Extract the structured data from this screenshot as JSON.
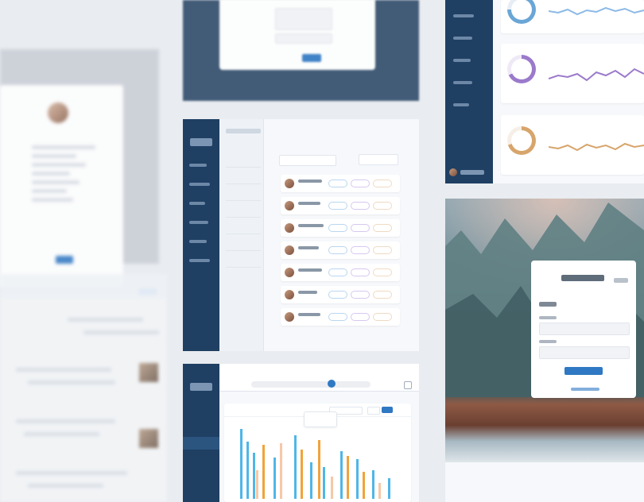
{
  "screens": {
    "top_center_dialog": {
      "title": "",
      "fields": [
        {
          "label": "",
          "value": ""
        },
        {
          "label": "",
          "value": ""
        },
        {
          "label": "",
          "value": ""
        }
      ],
      "buttons": [
        {
          "label": ""
        },
        {
          "label": ""
        }
      ]
    },
    "left_profile_dialog": {
      "title": "",
      "lines": [
        ""
      ],
      "button": ""
    },
    "list_screen": {
      "title": "",
      "subtitle": "",
      "sidebar_items": [
        "",
        "",
        "",
        "",
        "",
        "",
        "",
        ""
      ],
      "filter_items": [
        "",
        "",
        "",
        "",
        "",
        "",
        ""
      ],
      "search_placeholder": "",
      "sort_label": "",
      "rows": [
        {
          "name": "",
          "meta": "",
          "tags": [
            "",
            "",
            ""
          ]
        },
        {
          "name": "",
          "meta": "",
          "tags": [
            "",
            "",
            ""
          ]
        },
        {
          "name": "",
          "meta": "",
          "tags": [
            "",
            "",
            ""
          ]
        },
        {
          "name": "",
          "meta": "",
          "tags": [
            "",
            "",
            ""
          ]
        },
        {
          "name": "",
          "meta": "",
          "tags": [
            "",
            "",
            ""
          ]
        },
        {
          "name": "",
          "meta": "",
          "tags": [
            "",
            "",
            ""
          ]
        },
        {
          "name": "",
          "meta": "",
          "tags": [
            "",
            "",
            ""
          ]
        }
      ]
    },
    "analytics_screen": {
      "sidebar_items": [
        "",
        "",
        "",
        "",
        ""
      ],
      "kpis": [
        {
          "label": "",
          "value": ""
        },
        {
          "label": "",
          "value": ""
        },
        {
          "label": "",
          "value": ""
        }
      ],
      "footer_user": ""
    },
    "bar_chart_screen": {
      "title": "",
      "subtitle": "",
      "paginator": "",
      "chart_title": "",
      "legend": [
        "",
        "",
        ""
      ],
      "tooltip": ""
    },
    "login_screen": {
      "brand": "",
      "language": "",
      "heading": "",
      "field_labels": [
        "",
        ""
      ],
      "button": "",
      "link": ""
    }
  },
  "colors": {
    "navy": "#1f3f63",
    "accent": "#2f78c3",
    "bg": "#e9ecf0",
    "ring_blue": "#6aa6d6",
    "ring_purple": "#9b7acb",
    "ring_gold": "#d7a56b",
    "line_blue": "#8cb9e6",
    "line_purple": "#9b7acb",
    "line_gold": "#d7a56b",
    "bar_blue": "#4fb6e7",
    "bar_orange": "#f1a33b",
    "bar_peach": "#f7c7a6"
  },
  "icons": {
    "menu": "hamburger-icon",
    "search": "search-icon",
    "settings": "gear-icon",
    "paginator_prev": "chevron-left-icon",
    "paginator_next": "chevron-right-icon"
  }
}
